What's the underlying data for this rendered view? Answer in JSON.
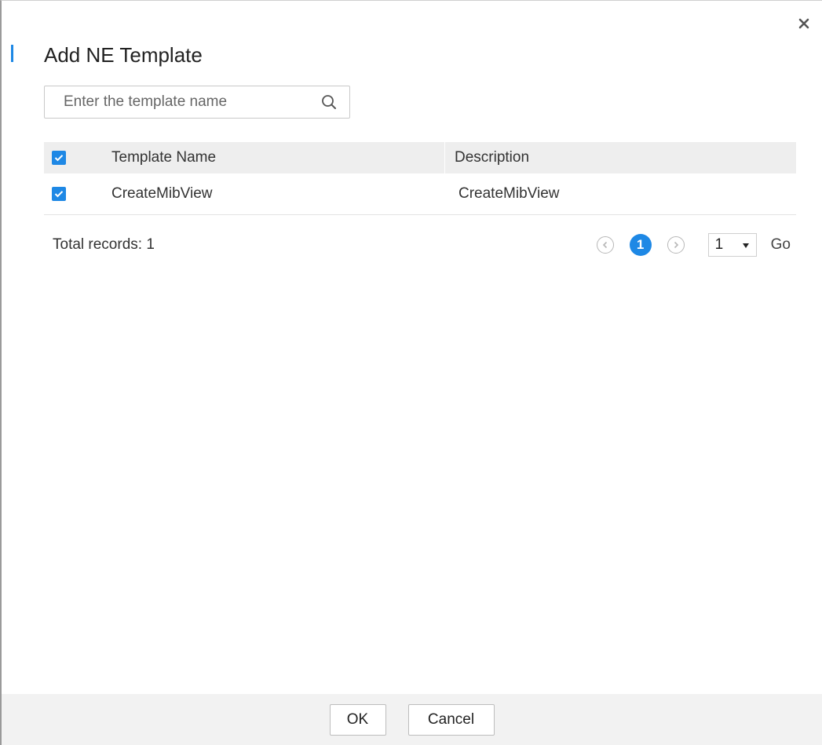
{
  "dialog": {
    "title": "Add NE Template",
    "close_icon": "close-icon",
    "accent_color": "#1e88e5"
  },
  "search": {
    "placeholder": "Enter the template name",
    "value": "",
    "icon": "search-icon"
  },
  "table": {
    "header_checked": true,
    "columns": [
      "Template Name",
      "Description"
    ],
    "rows": [
      {
        "checked": true,
        "name": "CreateMibView",
        "description": "CreateMibView"
      }
    ]
  },
  "pagination": {
    "total_label": "Total records: 1",
    "current_page": "1",
    "page_select": "1",
    "go_label": "Go",
    "prev_icon": "chevron-left-circle-icon",
    "next_icon": "chevron-right-circle-icon"
  },
  "footer": {
    "ok_label": "OK",
    "cancel_label": "Cancel"
  }
}
